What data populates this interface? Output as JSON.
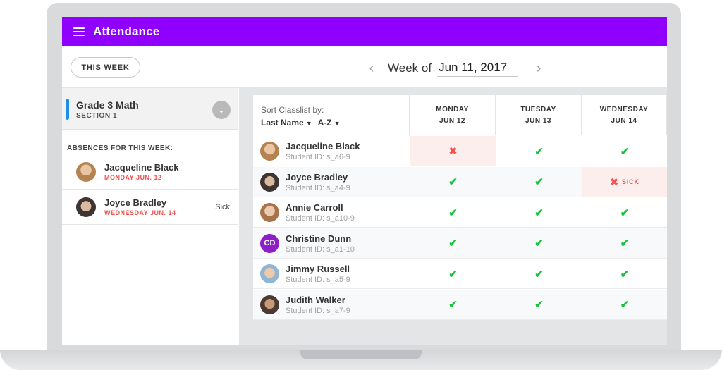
{
  "app": {
    "title": "Attendance"
  },
  "toolbar": {
    "this_week_label": "THIS WEEK",
    "week_prefix": "Week of",
    "week_date": "Jun 11, 2017"
  },
  "sidebar": {
    "class_name": "Grade 3 Math",
    "section": "SECTION 1",
    "absences_heading": "ABSENCES FOR THIS WEEK:",
    "absences": [
      {
        "name": "Jacqueline Black",
        "date": "MONDAY JUN. 12",
        "note": "",
        "avatar": "avatar-icon"
      },
      {
        "name": "Joyce Bradley",
        "date": "WEDNESDAY JUN. 14",
        "note": "Sick",
        "avatar": "avatar-icon"
      }
    ]
  },
  "classlist": {
    "sort_label": "Sort Classlist by:",
    "sort_field": "Last Name",
    "sort_order": "A-Z",
    "days": [
      {
        "name": "MONDAY",
        "date": "JUN 12"
      },
      {
        "name": "TUESDAY",
        "date": "JUN 13"
      },
      {
        "name": "WEDNESDAY",
        "date": "JUN 14"
      }
    ],
    "students": [
      {
        "name": "Jacqueline Black",
        "id": "Student ID: s_a6-9",
        "initials": "",
        "attendance": [
          "absent",
          "present",
          "present"
        ]
      },
      {
        "name": "Joyce Bradley",
        "id": "Student ID: s_a4-9",
        "initials": "",
        "attendance": [
          "present",
          "present",
          "absent"
        ]
      },
      {
        "name": "Annie Carroll",
        "id": "Student ID: s_a10-9",
        "initials": "",
        "attendance": [
          "present",
          "present",
          "present"
        ]
      },
      {
        "name": "Christine Dunn",
        "id": "Student ID: s_a1-10",
        "initials": "CD",
        "attendance": [
          "present",
          "present",
          "present"
        ]
      },
      {
        "name": "Jimmy Russell",
        "id": "Student ID: s_a5-9",
        "initials": "",
        "attendance": [
          "present",
          "present",
          "present"
        ]
      },
      {
        "name": "Judith Walker",
        "id": "Student ID: s_a7-9",
        "initials": "",
        "attendance": [
          "present",
          "present",
          "present"
        ]
      }
    ],
    "sick_label": "SICK"
  },
  "colors": {
    "brand": "#8f00ff",
    "present": "#16c43c",
    "absent": "#f05151",
    "accent": "#1f8ee6"
  },
  "icons": {
    "menu": "hamburger-icon",
    "prev": "chevron-left-icon",
    "next": "chevron-right-icon",
    "expand": "chevron-down-icon",
    "present": "check-icon",
    "absent": "x-icon"
  }
}
